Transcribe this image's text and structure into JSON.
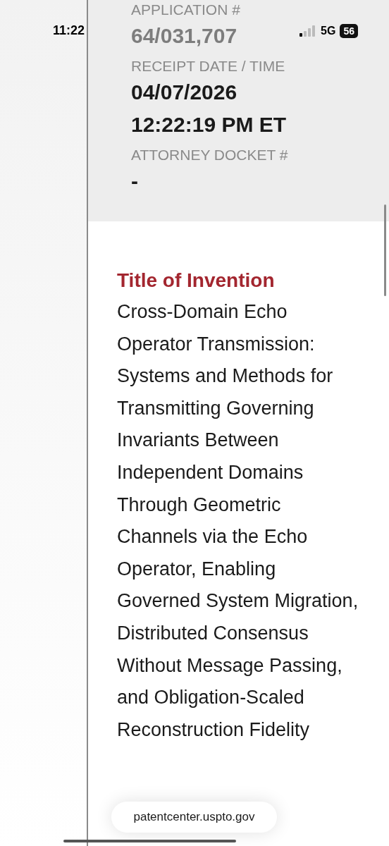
{
  "status_bar": {
    "time": "11:22",
    "network": "5G",
    "battery": "56"
  },
  "details": [
    {
      "label": "APPLICATION #",
      "value": "64/031,707",
      "faded": true
    },
    {
      "label": "RECEIPT DATE / TIME",
      "value": "04/07/2026 12:22:19 PM ET",
      "faded": false
    },
    {
      "label": "ATTORNEY DOCKET #",
      "value": "-",
      "faded": false
    }
  ],
  "title_section": {
    "heading": "Title of Invention",
    "text": "Cross-Domain Echo Operator Transmission: Systems and Methods for Transmitting Governing Invariants Between Independent Domains Through Geometric Channels via the Echo Operator, Enabling Governed System Migration, Distributed Consensus Without Message Passing, and Obligation-Scaled Reconstruction Fidelity"
  },
  "browser": {
    "url": "patentcenter.uspto.gov"
  }
}
